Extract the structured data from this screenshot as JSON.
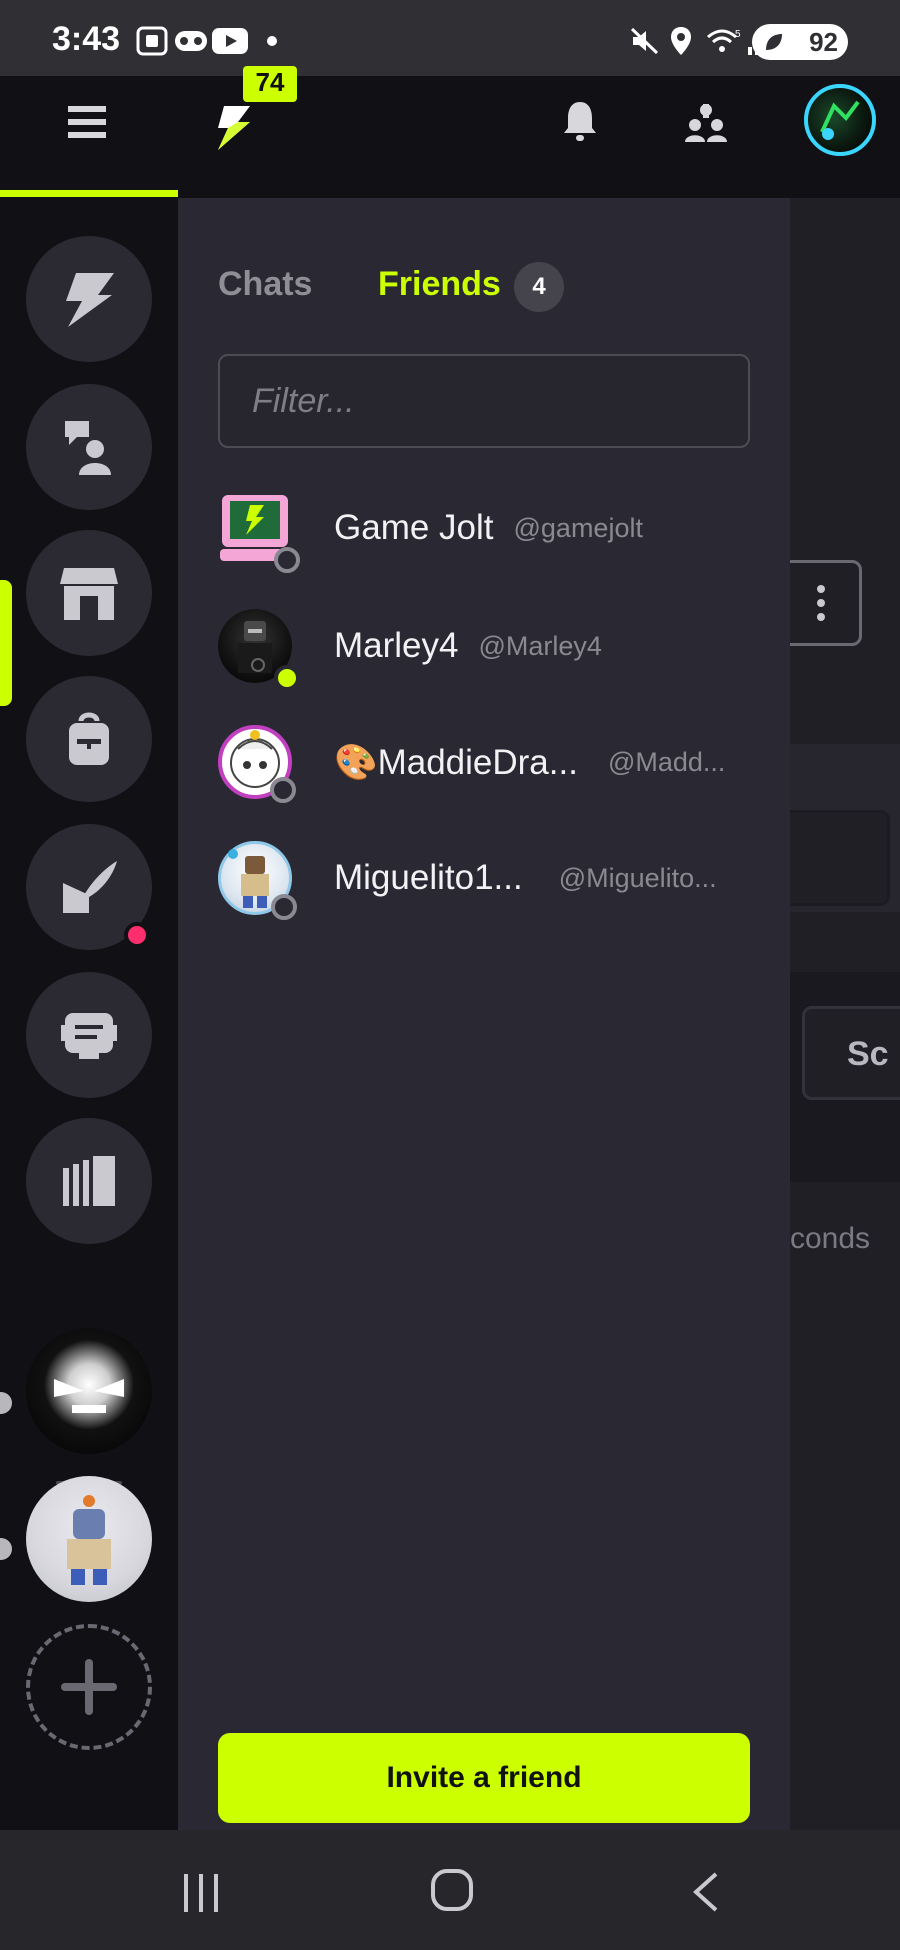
{
  "status_bar": {
    "time": "3:43",
    "battery": "92"
  },
  "topbar": {
    "badge": "74"
  },
  "panel": {
    "tabs": {
      "chats": "Chats",
      "friends": "Friends",
      "friends_count": "4"
    },
    "filter_placeholder": "Filter...",
    "friends": [
      {
        "name": "Game Jolt",
        "handle": "@gamejolt",
        "online": false
      },
      {
        "name": "Marley4",
        "handle": "@Marley4",
        "online": true
      },
      {
        "name": "🎨MaddieDra...",
        "handle": "@Madd...",
        "online": false
      },
      {
        "name": "Miguelito1...",
        "handle": "@Miguelito...",
        "online": false
      }
    ],
    "invite_label": "Invite a friend"
  },
  "background": {
    "partial_tab": "Sc",
    "partial_text": "conds"
  },
  "colors": {
    "accent": "#ccff00",
    "panel": "#2a2933",
    "rail": "#111015",
    "notification": "#ff2f6d"
  }
}
